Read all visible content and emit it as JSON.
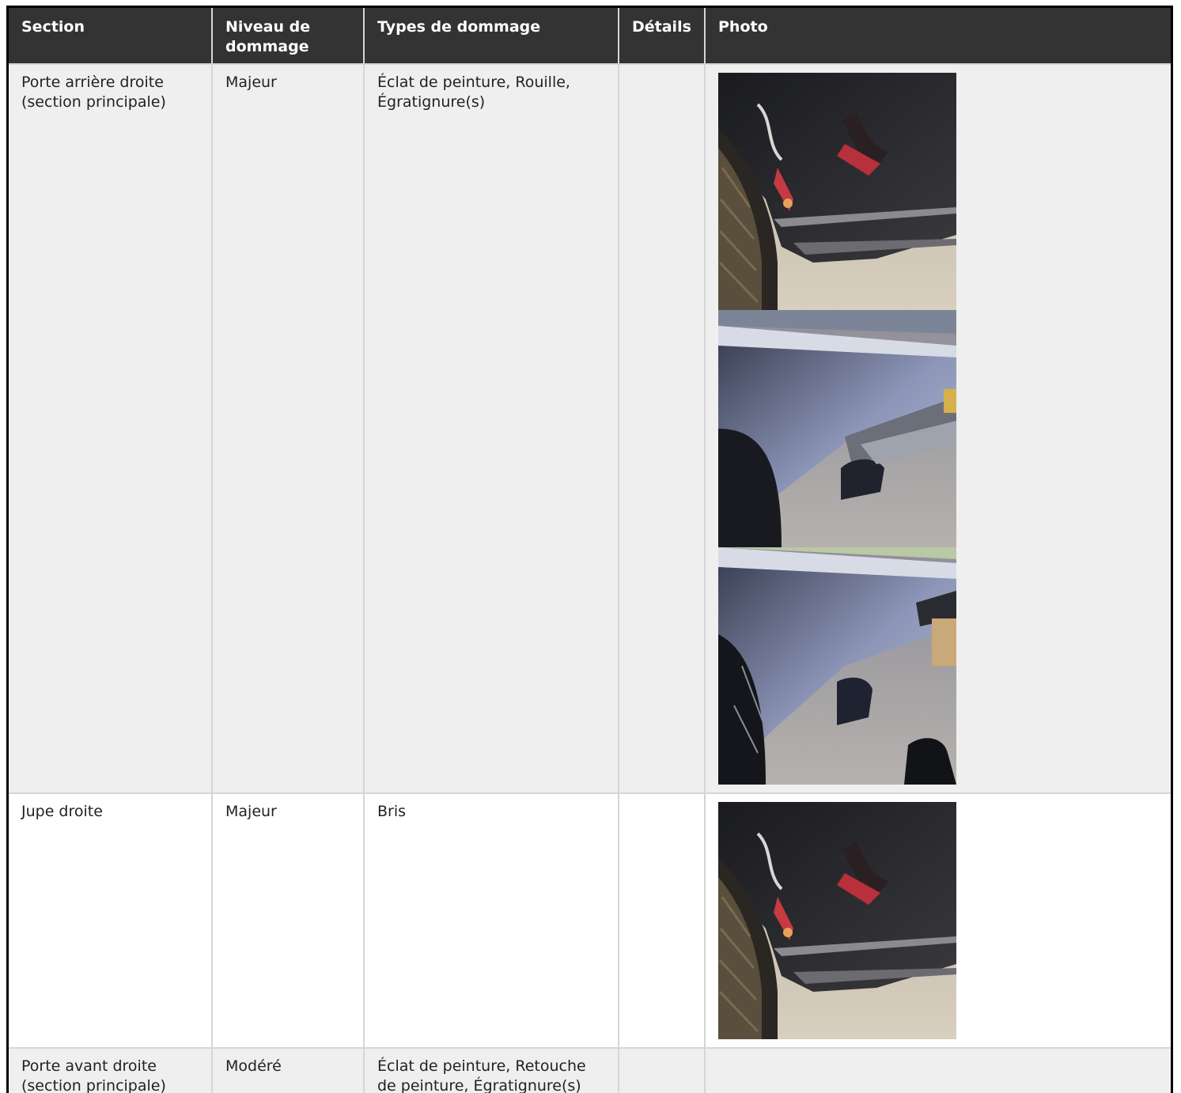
{
  "table": {
    "headers": {
      "section": "Section",
      "level": "Niveau de dommage",
      "types": "Types de dommage",
      "details": "Détails",
      "photo": "Photo"
    },
    "rows": [
      {
        "section": "Porte arrière droite (section principale)",
        "level": "Majeur",
        "types": "Éclat de peinture, Rouille, Égratignure(s)",
        "details": "",
        "photos": [
          "tire-scratch-photo",
          "door-reflection-photo",
          "door-handle-reflection-photo"
        ]
      },
      {
        "section": "Jupe droite",
        "level": "Majeur",
        "types": "Bris",
        "details": "",
        "photos": [
          "tire-scratch-photo"
        ]
      },
      {
        "section": "Porte avant droite (section principale)",
        "level": "Modéré",
        "types": "Éclat de peinture, Retouche de peinture, Égratignure(s)",
        "details": "",
        "photos": []
      }
    ]
  },
  "colors": {
    "header_bg": "#333333",
    "row_shade": "#efefef",
    "grid": "#d6d6d6"
  }
}
